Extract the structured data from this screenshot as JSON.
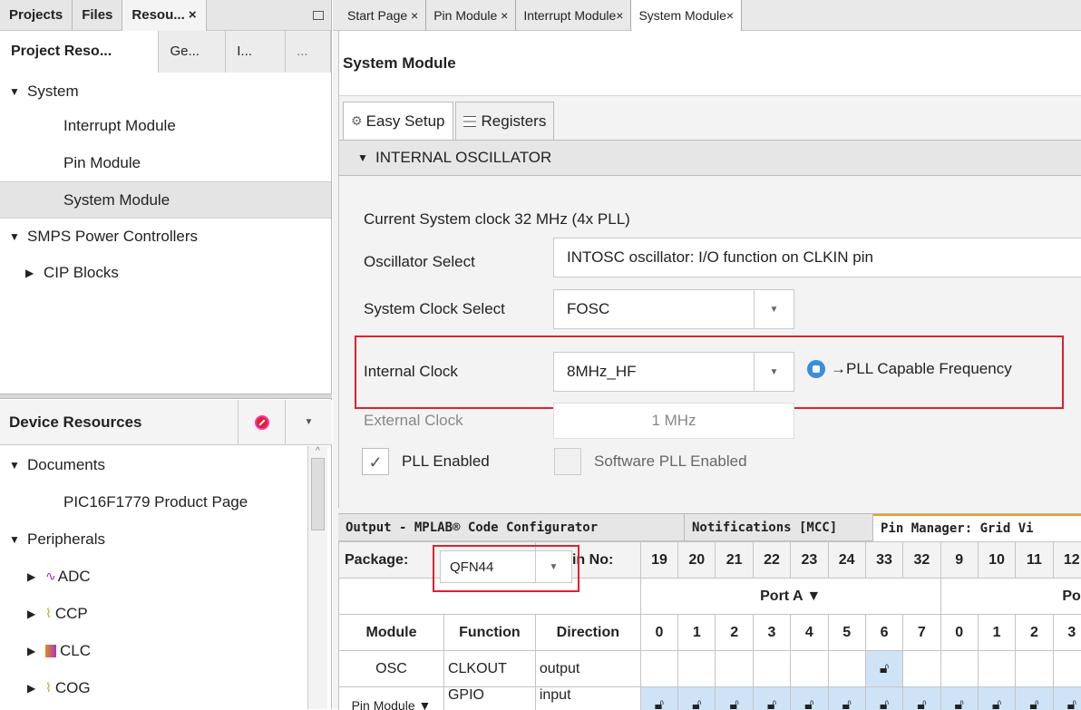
{
  "left": {
    "tabs": [
      "Projects",
      "Files",
      "Resou... ×"
    ],
    "subtabs": [
      "Project Reso...",
      "Ge...",
      "I...",
      "..."
    ],
    "tree": [
      {
        "label": "System",
        "expanded": true
      },
      {
        "label": "Interrupt Module"
      },
      {
        "label": "Pin Module"
      },
      {
        "label": "System Module",
        "selected": true
      },
      {
        "label": "SMPS Power Controllers",
        "expanded": true
      },
      {
        "label": "CIP Blocks",
        "expanded": false
      }
    ],
    "device_resources": {
      "title": "Device Resources",
      "items": [
        {
          "label": "Documents",
          "expanded": true
        },
        {
          "label": "PIC16F1779 Product Page"
        },
        {
          "label": "Peripherals",
          "expanded": true
        },
        {
          "label": "ADC",
          "icon": "adc-icon"
        },
        {
          "label": "CCP",
          "icon": "ccp-icon"
        },
        {
          "label": "CLC",
          "icon": "clc-icon"
        },
        {
          "label": "COG",
          "icon": "cog-icon"
        }
      ]
    }
  },
  "doctabs": [
    "Start Page ×",
    "Pin Module ×",
    "Interrupt Module×",
    "System Module×"
  ],
  "system_module": {
    "title": "System Module",
    "tabs": [
      "Easy Setup",
      "Registers"
    ],
    "section": "INTERNAL OSCILLATOR",
    "current_clock": "Current System clock  32 MHz  (4x PLL)",
    "osc_select_label": "Oscillator Select",
    "osc_select_value": "INTOSC oscillator: I/O function on CLKIN pin",
    "sysclk_label": "System Clock Select",
    "sysclk_value": "FOSC",
    "intclk_label": "Internal Clock",
    "intclk_value": "8MHz_HF",
    "pll_note": "→PLL Capable Frequency",
    "extclk_label": "External Clock",
    "extclk_value": "1 MHz",
    "pll_enabled": "PLL Enabled",
    "sw_pll": "Software PLL Enabled"
  },
  "bottom": {
    "tabs": [
      "Output - MPLAB® Code Configurator",
      "Notifications [MCC]",
      "Pin Manager: Grid Vi"
    ],
    "package_label": "Package:",
    "package_value": "QFN44",
    "pinno_label": "Pin No:",
    "pins": [
      "19",
      "20",
      "21",
      "22",
      "23",
      "24",
      "33",
      "32",
      "9",
      "10",
      "11",
      "12"
    ],
    "porta": "Port A ▼",
    "portb": "Por",
    "headers": [
      "Module",
      "Function",
      "Direction"
    ],
    "bits": [
      "0",
      "1",
      "2",
      "3",
      "4",
      "5",
      "6",
      "7",
      "0",
      "1",
      "2",
      "3"
    ],
    "rows": [
      {
        "module": "OSC",
        "function": "CLKOUT",
        "direction": "output"
      },
      {
        "module": "Pin Module ▼",
        "function": "GPIO",
        "direction": "input"
      }
    ]
  },
  "colors": {
    "highlight_red": "#e0202e",
    "grid_blue": "#cfe3f7",
    "info_blue": "#3b8de0"
  }
}
